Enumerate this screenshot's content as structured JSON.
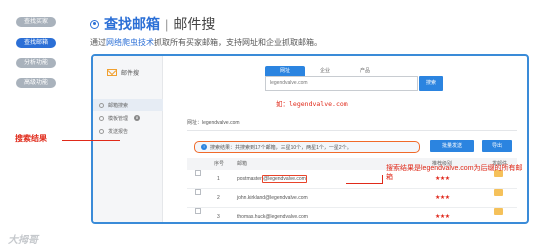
{
  "nav": {
    "items": [
      "查找买家",
      "查找邮箱",
      "分析功能",
      "高级功能"
    ],
    "active": 1
  },
  "heading": {
    "main": "查找邮箱",
    "separator": "|",
    "sub": "邮件搜"
  },
  "description": {
    "before": "通过",
    "highlight": "网络爬虫技术",
    "after": "抓取所有买家邮箱，支持网址和企业抓取邮箱。"
  },
  "app": {
    "logo": "邮件搜",
    "sidebar": [
      {
        "label": "邮箱搜索"
      },
      {
        "label": "模板管理",
        "badge": "8"
      },
      {
        "label": "发送报告"
      }
    ],
    "tabs": [
      "网址",
      "企业",
      "产品"
    ],
    "search_value": "legendvalve.com",
    "search_button": "搜索",
    "example": "如：legendvalve.com",
    "domain_line": "网址：legendvalve.com",
    "result_summary": "搜索结果：共搜索到17个邮箱，三星10个，两星1个，一星2个。",
    "btn_batch_export": "批量发送",
    "btn_export": "导出",
    "columns": [
      "序号",
      "邮箱",
      "推荐级别",
      "发邮件"
    ],
    "rows": [
      {
        "index": "1",
        "email_user": "postmaster",
        "email_domain": "@legendvalve.com",
        "rating": "★★★"
      },
      {
        "index": "2",
        "email_user": "john.kirkland",
        "email_domain": "@legendvalve.com",
        "rating": "★★★"
      },
      {
        "index": "3",
        "email_user": "thomas.huck",
        "email_domain": "@legendvalve.com",
        "rating": "★★★"
      }
    ]
  },
  "annotations": {
    "note": "搜索结果是legendvalve.com为后缀的所有邮箱",
    "callout": "搜索结果"
  },
  "watermark": "大拇哥",
  "colors": {
    "accent": "#2b6fd6",
    "annotation": "#e02a1a",
    "panel_border": "#3a8bd8"
  }
}
